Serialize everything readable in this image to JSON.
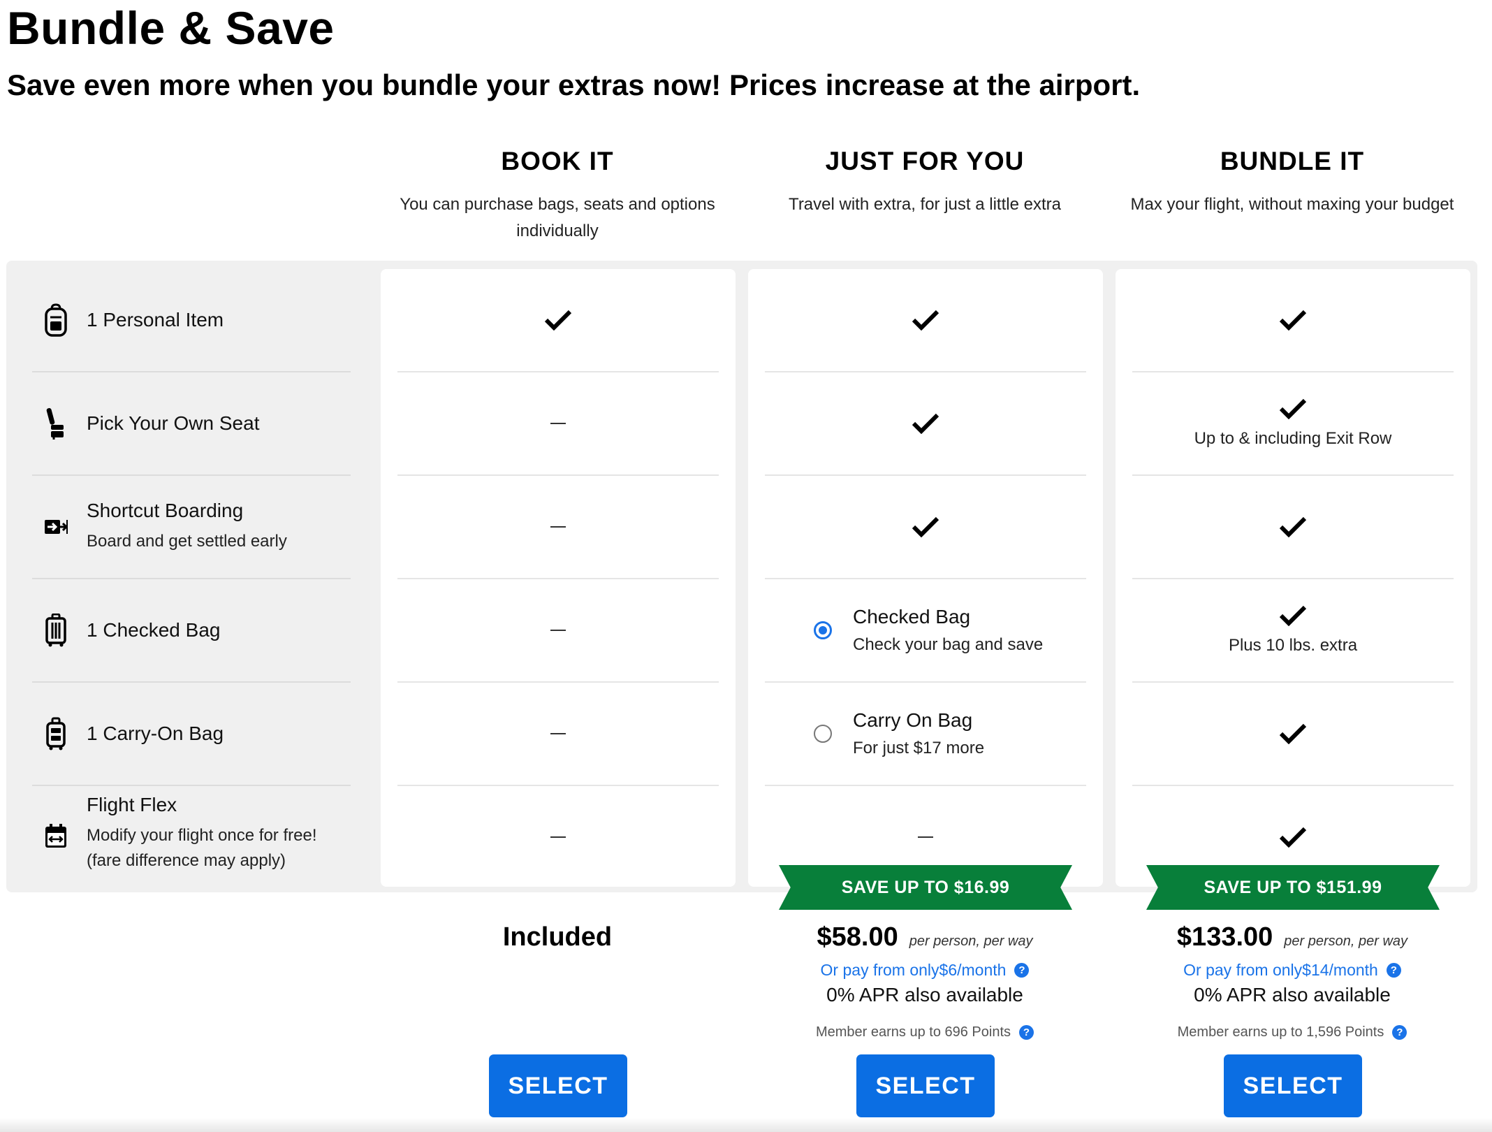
{
  "page": {
    "title": "Bundle & Save",
    "subtitle": "Save even more when you bundle your extras now! Prices increase at the airport."
  },
  "features": [
    {
      "title": "1 Personal Item",
      "subtitle": "",
      "icon": "backpack-icon"
    },
    {
      "title": "Pick Your Own Seat",
      "subtitle": "",
      "icon": "seat-icon"
    },
    {
      "title": "Shortcut Boarding",
      "subtitle": "Board and get settled early",
      "icon": "boarding-icon"
    },
    {
      "title": "1 Checked Bag",
      "subtitle": "",
      "icon": "checked-bag-icon"
    },
    {
      "title": "1 Carry-On Bag",
      "subtitle": "",
      "icon": "carry-on-icon"
    },
    {
      "title": "Flight Flex",
      "subtitle": "Modify your flight once for free! (fare difference may apply)",
      "icon": "calendar-swap-icon"
    }
  ],
  "plans": [
    {
      "name": "BOOK IT",
      "description": "You can purchase bags, seats and options individually",
      "price_text": "Included",
      "select_label": "SELECT"
    },
    {
      "name": "JUST FOR YOU",
      "description": "Travel with extra, for just a little extra",
      "options": [
        {
          "title": "Checked Bag",
          "subtitle": "Check your bag and save",
          "selected": true
        },
        {
          "title": "Carry On Bag",
          "subtitle": "For just $17 more",
          "selected": false
        }
      ],
      "ribbon": "SAVE UP TO $16.99",
      "price": "$58.00",
      "per": "per person, per way",
      "finance": "Or pay from only$6/month",
      "apr": "0% APR also available",
      "points": "Member earns up to 696 Points",
      "select_label": "SELECT"
    },
    {
      "name": "BUNDLE IT",
      "description": "Max your flight, without maxing your budget",
      "notes": {
        "seat": "Up to & including Exit Row",
        "checked_bag": "Plus 10 lbs. extra"
      },
      "ribbon": "SAVE UP TO $151.99",
      "price": "$133.00",
      "per": "per person, per way",
      "finance": "Or pay from only$14/month",
      "apr": "0% APR also available",
      "points": "Member earns up to 1,596 Points",
      "select_label": "SELECT"
    }
  ],
  "colors": {
    "accent": "#1a73e8",
    "button": "#0b6ee3",
    "ribbon": "#087f3a",
    "panel": "#f0f0f0"
  },
  "help_glyph": "?"
}
